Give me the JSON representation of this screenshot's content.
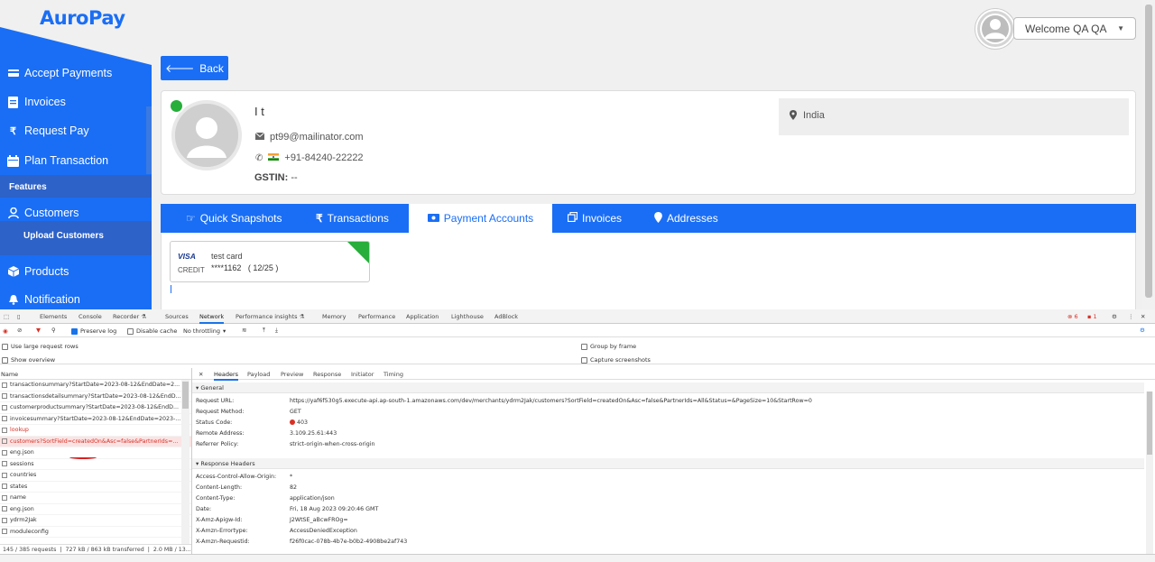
{
  "app": {
    "logo": "AuroPay",
    "welcome": "Welcome QA QA"
  },
  "sidebar": {
    "items": [
      {
        "label": "Accept Payments",
        "icon": "payments-icon"
      },
      {
        "label": "Invoices",
        "icon": "invoice-icon"
      },
      {
        "label": "Request Pay",
        "icon": "rupee-icon"
      },
      {
        "label": "Plan Transaction",
        "icon": "calendar-icon"
      },
      {
        "label": "Customers",
        "icon": "user-icon"
      },
      {
        "label": "Products",
        "icon": "cube-icon"
      },
      {
        "label": "Notification",
        "icon": "bell-icon"
      }
    ],
    "features_label": "Features",
    "upload_customers": "Upload Customers"
  },
  "back_label": "Back",
  "profile": {
    "name": "I t",
    "email": "pt99@mailinator.com",
    "phone": "+91-84240-22222",
    "gstin_label": "GSTIN:",
    "gstin_value": "--",
    "location": "India"
  },
  "tabs": [
    {
      "label": "Quick Snapshots",
      "icon": "hand-icon"
    },
    {
      "label": "Transactions",
      "icon": "rupee-icon"
    },
    {
      "label": "Payment Accounts",
      "icon": "card-icon",
      "active": true
    },
    {
      "label": "Invoices",
      "icon": "copy-icon"
    },
    {
      "label": "Addresses",
      "icon": "map-pin-icon"
    }
  ],
  "payment_card": {
    "brand": "VISA",
    "type": "CREDIT",
    "name": "test card",
    "number": "****1162",
    "expiry": "( 12/25 )"
  },
  "devtools": {
    "tabs": [
      "Elements",
      "Console",
      "Recorder ⚗",
      "Sources",
      "Network",
      "Performance insights ⚗",
      "Memory",
      "Performance",
      "Application",
      "Lighthouse",
      "AdBlock"
    ],
    "active_tab": "Network",
    "error_count": "6",
    "warning_count": "1",
    "toolbar": {
      "preserve_log": "Preserve log",
      "disable_cache": "Disable cache",
      "throttling": "No throttling"
    },
    "options": {
      "large_rows": "Use large request rows",
      "show_overview": "Show overview",
      "group_by_frame": "Group by frame",
      "capture_screenshots": "Capture screenshots"
    },
    "name_header": "Name",
    "requests": [
      {
        "name": "transactionsummary?StartDate=2023-08-12&EndDate=2...",
        "error": false
      },
      {
        "name": "transactionsdetailsummary?StartDate=2023-08-12&EndD...",
        "error": false
      },
      {
        "name": "customerproductsummary?StartDate=2023-08-12&EndD...",
        "error": false
      },
      {
        "name": "invoicesummary?StartDate=2023-08-12&EndDate=2023-...",
        "error": false
      },
      {
        "name": "lookup",
        "error": true
      },
      {
        "name": "customers?SortField=createdOn&Asc=false&PartnerIds=...",
        "error": true
      },
      {
        "name": "eng.json",
        "error": false
      },
      {
        "name": "sessions",
        "error": false
      },
      {
        "name": "countries",
        "error": false
      },
      {
        "name": "states",
        "error": false
      },
      {
        "name": "name",
        "error": false
      },
      {
        "name": "eng.json",
        "error": false
      },
      {
        "name": "ydrm2Jak",
        "error": false
      },
      {
        "name": "moduleconfig",
        "error": false
      }
    ],
    "status": {
      "requests": "145 / 385 requests",
      "transferred": "727 kB / 863 kB transferred",
      "resources": "2.0 MB / 13..."
    },
    "detail_tabs": [
      "Headers",
      "Payload",
      "Preview",
      "Response",
      "Initiator",
      "Timing"
    ],
    "general_label": "General",
    "general": [
      {
        "k": "Request URL:",
        "v": "https://yaf6f530g5.execute-api.ap-south-1.amazonaws.com/dev/merchants/ydrm2Jak/customers?SortField=createdOn&Asc=false&PartnerIds=All&Status=&PageSize=10&StartRow=0"
      },
      {
        "k": "Request Method:",
        "v": "GET"
      },
      {
        "k": "Status Code:",
        "v": "403"
      },
      {
        "k": "Remote Address:",
        "v": "3.109.25.61:443"
      },
      {
        "k": "Referrer Policy:",
        "v": "strict-origin-when-cross-origin"
      }
    ],
    "response_label": "Response Headers",
    "response": [
      {
        "k": "Access-Control-Allow-Origin:",
        "v": "*"
      },
      {
        "k": "Content-Length:",
        "v": "82"
      },
      {
        "k": "Content-Type:",
        "v": "application/json"
      },
      {
        "k": "Date:",
        "v": "Fri, 18 Aug 2023 09:20:46 GMT"
      },
      {
        "k": "X-Amz-Apigw-Id:",
        "v": "J2WtSE_aBcwFROg="
      },
      {
        "k": "X-Amzn-Errortype:",
        "v": "AccessDeniedException"
      },
      {
        "k": "X-Amzn-Requestid:",
        "v": "f26f0cac-078b-4b7e-b0b2-4908be2af743"
      }
    ]
  }
}
